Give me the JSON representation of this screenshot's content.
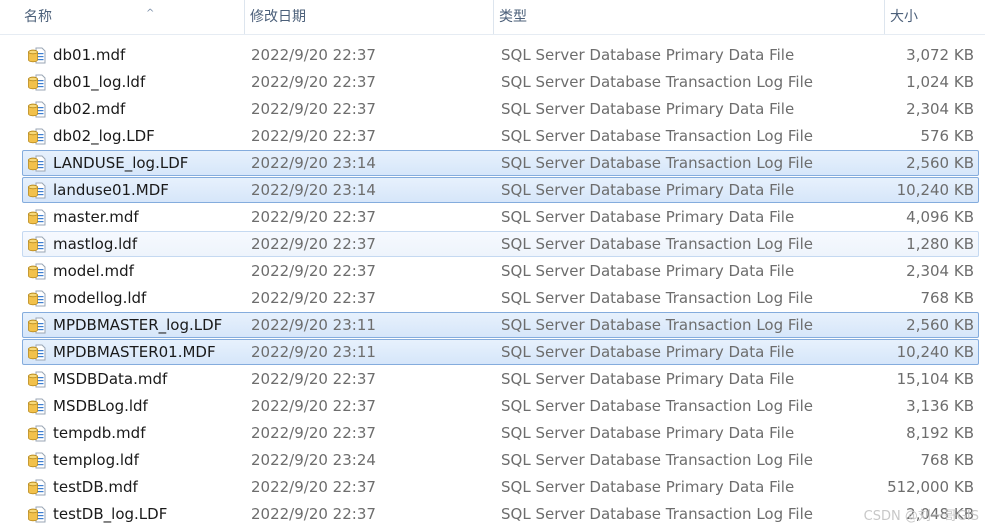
{
  "columns": {
    "name": "名称",
    "date": "修改日期",
    "type": "类型",
    "size": "大小"
  },
  "sort_indicator": "^",
  "files": [
    {
      "name": "db01.mdf",
      "date": "2022/9/20 22:37",
      "type": "SQL Server Database Primary Data File",
      "size": "3,072 KB",
      "state": "normal"
    },
    {
      "name": "db01_log.ldf",
      "date": "2022/9/20 22:37",
      "type": "SQL Server Database Transaction Log File",
      "size": "1,024 KB",
      "state": "normal"
    },
    {
      "name": "db02.mdf",
      "date": "2022/9/20 22:37",
      "type": "SQL Server Database Primary Data File",
      "size": "2,304 KB",
      "state": "normal"
    },
    {
      "name": "db02_log.LDF",
      "date": "2022/9/20 22:37",
      "type": "SQL Server Database Transaction Log File",
      "size": "576 KB",
      "state": "normal"
    },
    {
      "name": "LANDUSE_log.LDF",
      "date": "2022/9/20 23:14",
      "type": "SQL Server Database Transaction Log File",
      "size": "2,560 KB",
      "state": "selected"
    },
    {
      "name": "landuse01.MDF",
      "date": "2022/9/20 23:14",
      "type": "SQL Server Database Primary Data File",
      "size": "10,240 KB",
      "state": "selected"
    },
    {
      "name": "master.mdf",
      "date": "2022/9/20 22:37",
      "type": "SQL Server Database Primary Data File",
      "size": "4,096 KB",
      "state": "normal"
    },
    {
      "name": "mastlog.ldf",
      "date": "2022/9/20 22:37",
      "type": "SQL Server Database Transaction Log File",
      "size": "1,280 KB",
      "state": "hovered"
    },
    {
      "name": "model.mdf",
      "date": "2022/9/20 22:37",
      "type": "SQL Server Database Primary Data File",
      "size": "2,304 KB",
      "state": "normal"
    },
    {
      "name": "modellog.ldf",
      "date": "2022/9/20 22:37",
      "type": "SQL Server Database Transaction Log File",
      "size": "768 KB",
      "state": "normal"
    },
    {
      "name": "MPDBMASTER_log.LDF",
      "date": "2022/9/20 23:11",
      "type": "SQL Server Database Transaction Log File",
      "size": "2,560 KB",
      "state": "selected"
    },
    {
      "name": "MPDBMASTER01.MDF",
      "date": "2022/9/20 23:11",
      "type": "SQL Server Database Primary Data File",
      "size": "10,240 KB",
      "state": "selected"
    },
    {
      "name": "MSDBData.mdf",
      "date": "2022/9/20 22:37",
      "type": "SQL Server Database Primary Data File",
      "size": "15,104 KB",
      "state": "normal"
    },
    {
      "name": "MSDBLog.ldf",
      "date": "2022/9/20 22:37",
      "type": "SQL Server Database Transaction Log File",
      "size": "3,136 KB",
      "state": "normal"
    },
    {
      "name": "tempdb.mdf",
      "date": "2022/9/20 22:37",
      "type": "SQL Server Database Primary Data File",
      "size": "8,192 KB",
      "state": "normal"
    },
    {
      "name": "templog.ldf",
      "date": "2022/9/20 23:24",
      "type": "SQL Server Database Transaction Log File",
      "size": "768 KB",
      "state": "normal"
    },
    {
      "name": "testDB.mdf",
      "date": "2022/9/20 22:37",
      "type": "SQL Server Database Primary Data File",
      "size": "512,000 KB",
      "state": "normal"
    },
    {
      "name": "testDB_log.LDF",
      "date": "2022/9/20 22:37",
      "type": "SQL Server Database Transaction Log File",
      "size": "2,048 KB",
      "state": "normal"
    }
  ],
  "watermark": "CSDN @刘一哥GIS",
  "icon": "sql-database-file-icon",
  "colors": {
    "selected_bg": "#d9e8fb",
    "selected_border": "#84acdd",
    "icon_yellow": "#f2c14b",
    "icon_blue": "#3f7fd0"
  }
}
